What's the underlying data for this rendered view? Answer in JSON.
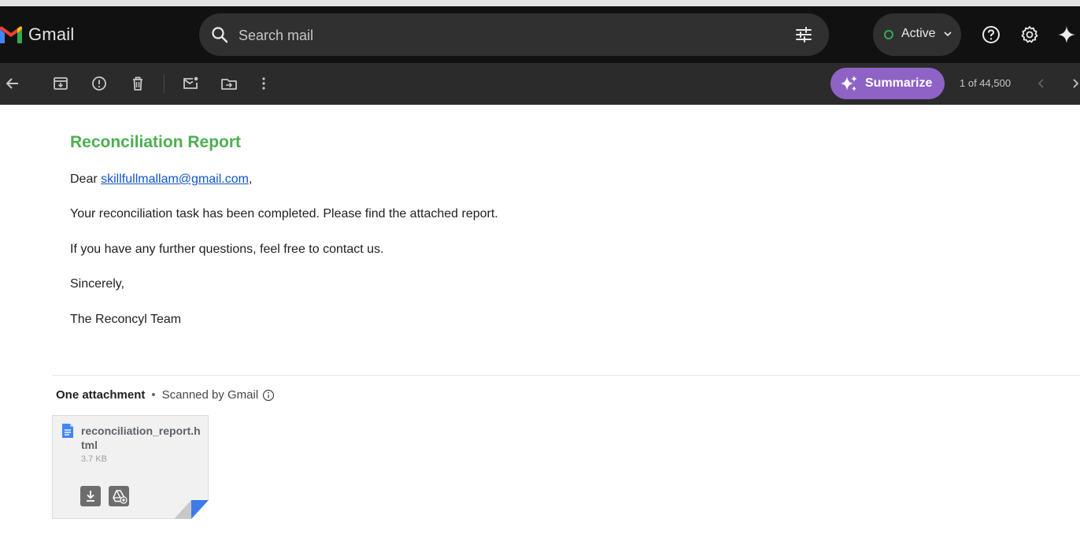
{
  "app": {
    "name": "Gmail"
  },
  "search": {
    "placeholder": "Search mail"
  },
  "status": {
    "label": "Active"
  },
  "toolbar": {
    "summarize_label": "Summarize",
    "pager_text": "1 of 44,500"
  },
  "email": {
    "title": "Reconciliation Report",
    "greeting_prefix": "Dear ",
    "greeting_email": "skillfullmallam@gmail.com",
    "greeting_suffix": ",",
    "line1": "Your reconciliation task has been completed. Please find the attached report.",
    "line2": "If you have any further questions, feel free to contact us.",
    "closing": "Sincerely,",
    "signature": "The Reconcyl Team"
  },
  "attachments": {
    "heading": "One attachment",
    "separator": "•",
    "scanned": "Scanned by Gmail",
    "items": [
      {
        "filename": "reconciliation_report.html",
        "size": "3.7 KB"
      }
    ]
  },
  "colors": {
    "header_bg": "#111111",
    "toolbar_bg": "#2b2b2b",
    "summarize_bg": "#8e63c5",
    "title_green": "#4caf50",
    "link_blue": "#1155cc",
    "active_green": "#34a853"
  },
  "icons": [
    "gmail-logo",
    "search-icon",
    "filter-icon",
    "chevron-down-icon",
    "help-icon",
    "settings-icon",
    "gemini-icon",
    "back-icon",
    "archive-icon",
    "report-spam-icon",
    "delete-icon",
    "mark-unread-icon",
    "move-to-icon",
    "more-icon",
    "sparkle-icon",
    "prev-icon",
    "next-icon",
    "info-icon",
    "document-icon",
    "download-icon",
    "add-to-drive-icon"
  ]
}
